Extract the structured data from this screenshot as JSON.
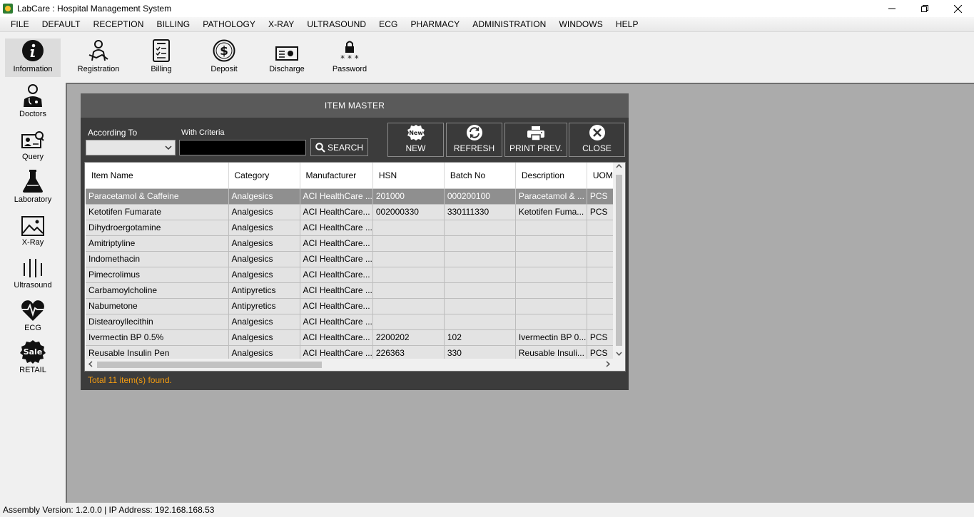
{
  "window": {
    "title": "LabCare : Hospital Management System"
  },
  "menu": [
    "FILE",
    "DEFAULT",
    "RECEPTION",
    "BILLING",
    "PATHOLOGY",
    "X-RAY",
    "ULTRASOUND",
    "ECG",
    "PHARMACY",
    "ADMINISTRATION",
    "WINDOWS",
    "HELP"
  ],
  "toolbar": {
    "information": "Information",
    "registration": "Registration",
    "billing": "Billing",
    "deposit": "Deposit",
    "discharge": "Discharge",
    "password": "Password"
  },
  "leftbar": {
    "doctors": "Doctors",
    "query": "Query",
    "laboratory": "Laboratory",
    "xray": "X-Ray",
    "ultrasound": "Ultrasound",
    "ecg": "ECG",
    "retail": "RETAIL",
    "retail_badge": "Sale"
  },
  "dialog": {
    "title": "ITEM MASTER",
    "according_to_label": "According To",
    "according_to_value": "",
    "criteria_label": "With Criteria",
    "criteria_value": "",
    "search_label": "SEARCH",
    "new_label": "NEW",
    "new_badge": "New",
    "refresh_label": "REFRESH",
    "print_label": "PRINT PREV.",
    "close_label": "CLOSE",
    "total_text": "Total 11 item(s) found."
  },
  "grid": {
    "columns": [
      "Item Name",
      "Category",
      "Manufacturer",
      "HSN",
      "Batch No",
      "Description",
      "UOM"
    ],
    "rows": [
      [
        "Paracetamol & Caffeine",
        "Analgesics",
        "ACI HealthCare ...",
        "201000",
        "000200100",
        "Paracetamol & ...",
        "PCS"
      ],
      [
        "Ketotifen Fumarate",
        "Analgesics",
        "ACI HealthCare...",
        "002000330",
        "330111330",
        "Ketotifen Fuma...",
        "PCS"
      ],
      [
        "Dihydroergotamine",
        "Analgesics",
        "ACI HealthCare ...",
        "",
        "",
        "",
        ""
      ],
      [
        "Amitriptyline",
        "Analgesics",
        "ACI HealthCare...",
        "",
        "",
        "",
        ""
      ],
      [
        "Indomethacin",
        "Analgesics",
        "ACI HealthCare ...",
        "",
        "",
        "",
        ""
      ],
      [
        "Pimecrolimus",
        "Analgesics",
        "ACI HealthCare...",
        "",
        "",
        "",
        ""
      ],
      [
        "Carbamoylcholine",
        "Antipyretics",
        "ACI HealthCare ...",
        "",
        "",
        "",
        ""
      ],
      [
        "Nabumetone",
        "Antipyretics",
        "ACI HealthCare...",
        "",
        "",
        "",
        ""
      ],
      [
        "Distearoyllecithin",
        "Analgesics",
        "ACI HealthCare ...",
        "",
        "",
        "",
        ""
      ],
      [
        "Ivermectin BP 0.5%",
        "Analgesics",
        "ACI HealthCare...",
        "2200202",
        "102",
        "Ivermectin BP 0...",
        "PCS"
      ],
      [
        "Reusable Insulin Pen",
        "Analgesics",
        "ACI HealthCare ...",
        "226363",
        "330",
        "Reusable Insuli...",
        "PCS"
      ]
    ],
    "selected_row": 0
  },
  "status": {
    "text": "Assembly Version: 1.2.0.0  |  IP Address: 192.168.168.53"
  }
}
